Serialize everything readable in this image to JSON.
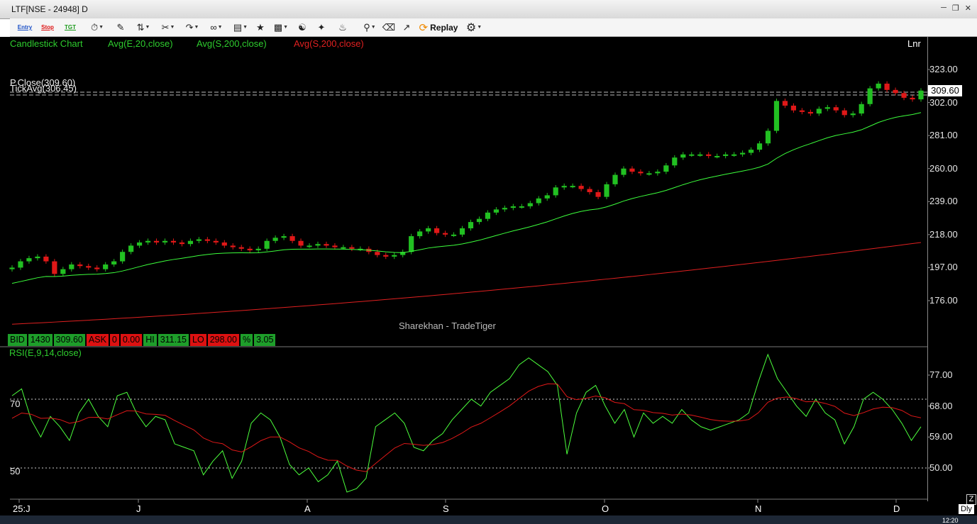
{
  "window": {
    "title": "LTF[NSE - 24948] D"
  },
  "toolbar": {
    "entry": "Entry",
    "stop": "Stop",
    "tgt": "TGT",
    "replay": "Replay"
  },
  "legend": {
    "chart": "Candlestick Chart",
    "ema20": "Avg(E,20,close)",
    "sma200_green": "Avg(S,200,close)",
    "sma200_red": "Avg(S,200,close)",
    "scale": "Lnr",
    "pclose": "P.Close(309.60)",
    "tickavg": "TickAvg(306.45)",
    "watermark": "Sharekhan - TradeTiger",
    "rsi": "RSI(E,9,14,close)"
  },
  "quote": {
    "bid_label": "BID",
    "bid_qty": "1430",
    "bid_price": "309.60",
    "ask_label": "ASK",
    "ask_qty": "0",
    "ask_price": "0.00",
    "hi_label": "HI",
    "hi_value": "311.15",
    "lo_label": "LO",
    "lo_value": "298.00",
    "pct_label": "%",
    "pct_value": "3.05"
  },
  "price_axis": {
    "ticks": [
      "323.00",
      "302.00",
      "281.00",
      "260.00",
      "239.00",
      "218.00",
      "197.00",
      "176.00"
    ],
    "last_price": "309.60"
  },
  "rsi_axis": {
    "ticks": [
      "77.00",
      "68.00",
      "59.00",
      "50.00"
    ],
    "levels": [
      "70",
      "50"
    ]
  },
  "x_axis": {
    "labels": [
      "25:J",
      "J",
      "A",
      "S",
      "O",
      "N",
      "D"
    ]
  },
  "controls": {
    "z": "Z",
    "dly": "Dly"
  },
  "status": {
    "clock": "12:20"
  },
  "colors": {
    "up": "#22c022",
    "down": "#e01818",
    "ema": "#3cff3c",
    "sma_red": "#e02020",
    "rsi": "#4cff3c",
    "rsi_avg": "#e01818"
  },
  "chart_data": {
    "type": "candlestick",
    "ylim": [
      160,
      330
    ],
    "closes": [
      197,
      201,
      203,
      204,
      201,
      193,
      196,
      199,
      198,
      197,
      196,
      199,
      201,
      207,
      211,
      213,
      214,
      213,
      214,
      213,
      212,
      214,
      215,
      214,
      213,
      211,
      210,
      209,
      208,
      209,
      214,
      216,
      217,
      214,
      211,
      211,
      212,
      211,
      210,
      210,
      209,
      209,
      207,
      205,
      204,
      205,
      207,
      217,
      220,
      222,
      219,
      218,
      218,
      222,
      226,
      228,
      232,
      234,
      235,
      236,
      236,
      238,
      241,
      243,
      248,
      249,
      249,
      247,
      245,
      242,
      250,
      256,
      260,
      258,
      257,
      257,
      258,
      262,
      267,
      269,
      269,
      269,
      268,
      268,
      269,
      269,
      270,
      272,
      276,
      284,
      303,
      300,
      297,
      296,
      295,
      298,
      299,
      297,
      294,
      295,
      301,
      311,
      314,
      310,
      308,
      305,
      304,
      309.6
    ],
    "ema20_end": 303,
    "sma200_range": [
      161,
      213
    ],
    "rsi": [
      71,
      73,
      64,
      59,
      65,
      62,
      58,
      66,
      70,
      65,
      62,
      71,
      72,
      66,
      62,
      65,
      64,
      57,
      56,
      55,
      48,
      52,
      55,
      47,
      52,
      63,
      66,
      64,
      59,
      51,
      48,
      50,
      46,
      48,
      52,
      43,
      44,
      47,
      62,
      64,
      66,
      63,
      56,
      55,
      58,
      60,
      64,
      67,
      70,
      68,
      72,
      74,
      76,
      80,
      82,
      80,
      78,
      74,
      54,
      66,
      72,
      74,
      68,
      63,
      67,
      59,
      66,
      63,
      65,
      63,
      67,
      64,
      62,
      61,
      62,
      63,
      64,
      66,
      75,
      83,
      76,
      72,
      68,
      65,
      70,
      66,
      64,
      57,
      62,
      70,
      72,
      70,
      67,
      63,
      58,
      62
    ],
    "rsi_ylim": [
      40,
      85
    ]
  }
}
